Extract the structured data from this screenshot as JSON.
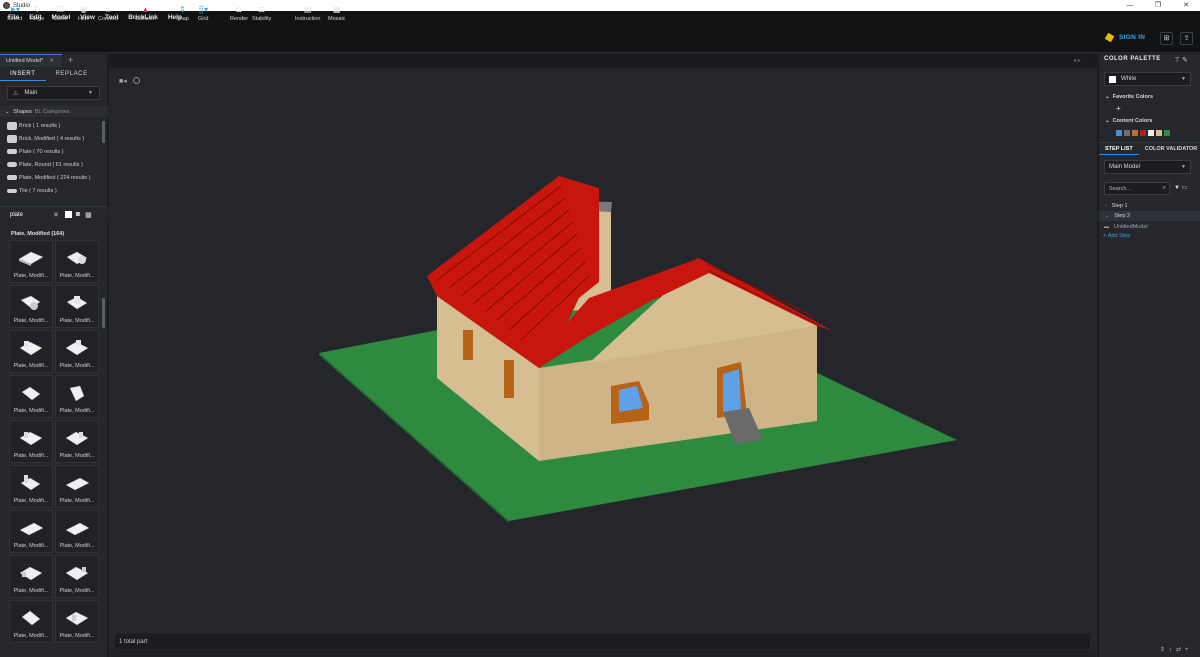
{
  "window": {
    "title": "Studio",
    "controls": [
      "—",
      "❐",
      "✕"
    ]
  },
  "menu": [
    "File",
    "Edit",
    "Model",
    "View",
    "Tool",
    "BrickLink",
    "Help"
  ],
  "toolbar": {
    "tools": [
      {
        "label": "Select",
        "icon": "cursor-icon"
      },
      {
        "label": "Hinge",
        "icon": "hinge-icon"
      },
      {
        "label": "Clone",
        "icon": "clone-icon"
      },
      {
        "label": "Hide",
        "icon": "hide-icon"
      },
      {
        "label": "Connect",
        "icon": "connect-icon"
      },
      {
        "label": "Collision",
        "icon": "collision-icon"
      },
      {
        "label": "Snap",
        "icon": "snap-icon"
      },
      {
        "label": "Grid",
        "icon": "grid-icon"
      },
      {
        "label": "Render",
        "icon": "camera-icon"
      },
      {
        "label": "Stability",
        "icon": "stability-icon"
      },
      {
        "label": "Instruction",
        "icon": "instruction-icon"
      },
      {
        "label": "Mosaic",
        "icon": "mosaic-icon"
      }
    ],
    "sign_in": "SIGN IN"
  },
  "document_tab": {
    "label": "Untitled Model*",
    "close": "✕",
    "add": "+"
  },
  "left_panel": {
    "tabs": [
      "INSERT",
      "REPLACE"
    ],
    "palette_select": "Main",
    "shapes_header": "Shapes",
    "categories_link": "BL Categories",
    "shape_items": [
      "Brick ( 1 results )",
      "Brick, Modified ( 4 results )",
      "Plate ( 70 results )",
      "Plate, Round ( 61 results )",
      "Plate, Modified ( 224 results )",
      "Tile ( 7 results )"
    ],
    "search_value": "plate",
    "results_header": "Plate, Modified (164)",
    "part_label": "Plate, Modifi..."
  },
  "viewport": {
    "status": "1 total part"
  },
  "right_panel": {
    "title": "COLOR PALETTE",
    "selected_color": "White",
    "favorite_colors": "Favorite Colors",
    "content_colors": "Content Colors",
    "content_swatches": [
      "#4a8fd1",
      "#6c6e72",
      "#c46c2a",
      "#b3221a",
      "#f2efe6",
      "#d8c08e",
      "#2e8a3c"
    ],
    "step_tabs": [
      "STEP LIST",
      "COLOR VALIDATOR"
    ],
    "model_select": "Main Model",
    "search_placeholder": "Search...",
    "steps": [
      "Step 1",
      "Step 2"
    ],
    "step_item": "UntitledModel",
    "add_step": "Add Step"
  }
}
